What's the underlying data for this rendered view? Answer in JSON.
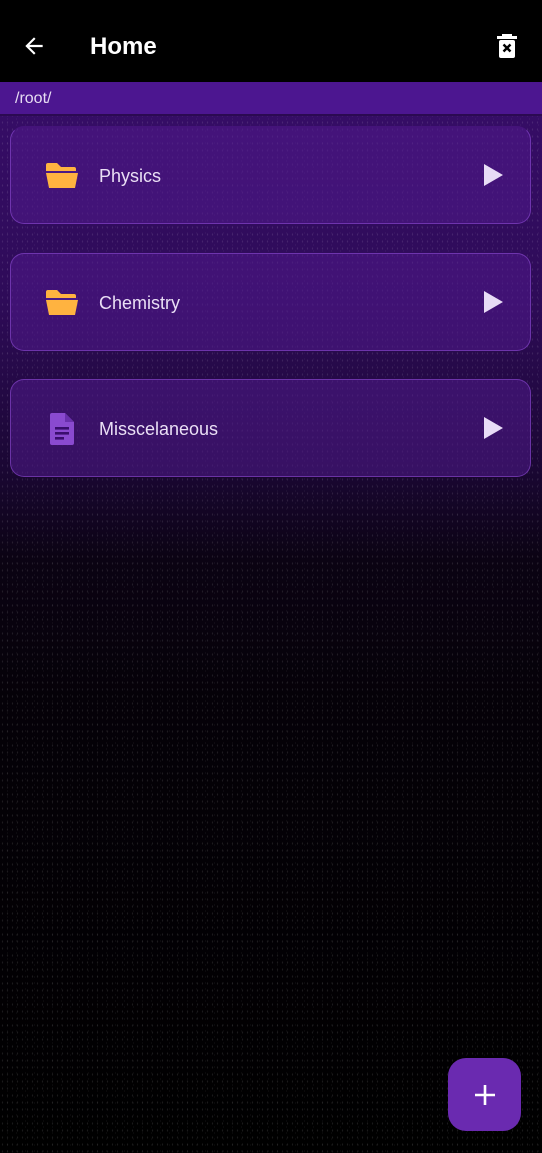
{
  "appbar": {
    "title": "Home",
    "back_icon": "arrow-left-icon",
    "delete_icon": "trash-x-icon"
  },
  "path": "/root/",
  "items": [
    {
      "label": "Physics",
      "icon": "folder-open-icon",
      "icon_color": "#ffb340"
    },
    {
      "label": "Chemistry",
      "icon": "folder-open-icon",
      "icon_color": "#ffb340"
    },
    {
      "label": "Misscelaneous",
      "icon": "document-icon",
      "icon_color": "#8a4ad0"
    }
  ],
  "fab": {
    "icon": "plus-icon"
  },
  "colors": {
    "accent": "#6a2ab0",
    "path_bar": "#4c1690",
    "card_bg": "#50198c",
    "folder": "#ffb340"
  }
}
